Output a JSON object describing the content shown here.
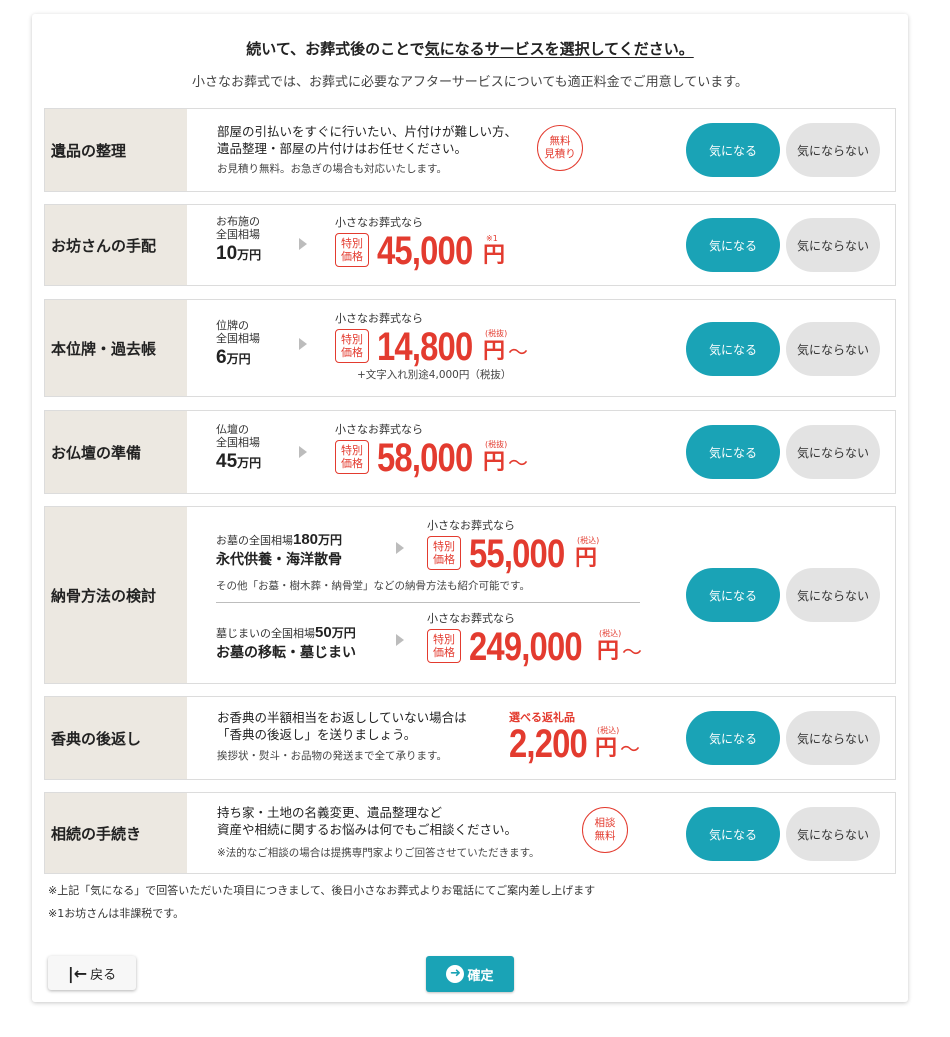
{
  "header": {
    "title_prefix": "続いて、お葬式後のことで",
    "title_underlined": "気になるサービスを選択してください。",
    "subtitle": "小さなお葬式では、お葬式に必要なアフターサービスについても適正料金でご用意しています。"
  },
  "buttons": {
    "yes": "気になる",
    "no": "気にならない"
  },
  "common": {
    "arrow": "",
    "nara": "小さなお葬式なら",
    "tag": "特別\n価格",
    "yen": "円",
    "tilde": "〜",
    "man_yen": "万円",
    "tax_excl": "(税抜)",
    "tax_incl": "(税込)"
  },
  "rows": {
    "ihin": {
      "label": "遺品の整理",
      "line1": "部屋の引払いをすぐに行いたい、片付けが難しい方、",
      "line2": "遺品整理・部屋の片付けはお任せください。",
      "note": "お見積り無料。お急ぎの場合も対応いたします。",
      "stamp": "無料\n見積り"
    },
    "obou": {
      "label": "お坊さんの手配",
      "avg1": "お布施の",
      "avg2": "全国相場",
      "avg_num": "10",
      "price": "45,000",
      "note": "※1"
    },
    "ihai": {
      "label": "本位牌・過去帳",
      "avg1": "位牌の",
      "avg2": "全国相場",
      "avg_num": "6",
      "price": "14,800",
      "extra": "+文字入れ別途4,000円（税抜）"
    },
    "butsudan": {
      "label": "お仏壇の準備",
      "avg1": "仏壇の",
      "avg2": "全国相場",
      "avg_num": "45",
      "price": "58,000"
    },
    "noukotsu": {
      "label": "納骨方法の検討",
      "a_avg_prefix": "お墓の全国相場",
      "a_avg_num": "180",
      "a_title": "永代供養・海洋散骨",
      "a_price": "55,000",
      "a_note": "その他「お墓・樹木葬・納骨堂」などの納骨方法も紹介可能です。",
      "b_avg_prefix": "墓じまいの全国相場",
      "b_avg_num": "50",
      "b_title": "お墓の移転・墓じまい",
      "b_price": "249,000"
    },
    "kouden": {
      "label": "香典の後返し",
      "line1": "お香典の半額相当をお返ししていない場合は",
      "line2": "「香典の後返し」を送りましょう。",
      "note": "挨拶状・熨斗・お品物の発送まで全て承ります。",
      "gift_label": "選べる返礼品",
      "price": "2,200"
    },
    "souzoku": {
      "label": "相続の手続き",
      "line1": "持ち家・土地の名義変更、遺品整理など",
      "line2": "資産や相続に関するお悩みは何でもご相談ください。",
      "note": "※法的なご相談の場合は提携専門家よりご回答させていただきます。",
      "stamp": "相談\n無料"
    }
  },
  "footnotes": {
    "line1": "※上記「気になる」で回答いただいた項目につきまして、後日小さなお葬式よりお電話にてご案内差し上げます",
    "line2": "※1お坊さんは非課税です。"
  },
  "footer": {
    "back": "戻る",
    "back_icon": "|←",
    "confirm": "確定",
    "confirm_icon": "➜"
  }
}
